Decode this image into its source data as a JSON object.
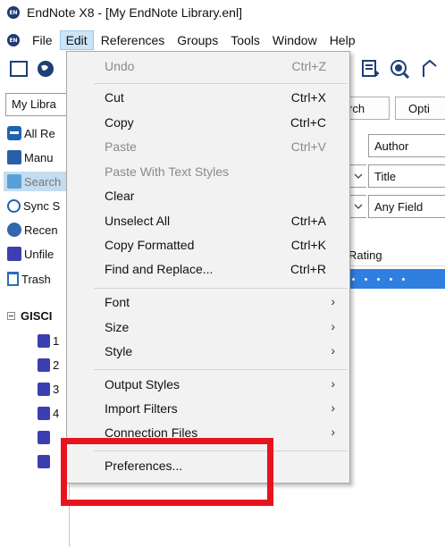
{
  "window": {
    "title": "EndNote X8 - [My EndNote Library.enl]",
    "app_badge": "EN"
  },
  "menubar": {
    "items": [
      "File",
      "Edit",
      "References",
      "Groups",
      "Tools",
      "Window",
      "Help"
    ],
    "active": "Edit"
  },
  "left_panel": {
    "library_dropdown": "My Libra",
    "items": [
      {
        "label": "All Re",
        "icon": "all-references-icon"
      },
      {
        "label": "Manu",
        "icon": "manuscript-icon"
      },
      {
        "label": "Search",
        "icon": "search-icon",
        "selected": true
      },
      {
        "label": "Sync S",
        "icon": "sync-status-icon"
      },
      {
        "label": "Recen",
        "icon": "recently-added-icon"
      },
      {
        "label": "Unfile",
        "icon": "unfiled-icon"
      },
      {
        "label": "Trash",
        "icon": "trash-icon"
      }
    ],
    "group_set": "GISCI",
    "groups": [
      "1",
      "2",
      "3",
      "4",
      "",
      ""
    ]
  },
  "right_panel": {
    "search_button_tail": "rch",
    "options_button": "Opti",
    "fields": [
      "Author",
      "Title",
      "Any Field"
    ],
    "rating_header": "Rating"
  },
  "edit_menu": {
    "items": [
      {
        "label": "Undo",
        "shortcut": "Ctrl+Z",
        "disabled": true
      },
      {
        "label": "Cut",
        "shortcut": "Ctrl+X"
      },
      {
        "label": "Copy",
        "shortcut": "Ctrl+C"
      },
      {
        "label": "Paste",
        "shortcut": "Ctrl+V",
        "disabled": true
      },
      {
        "label": "Paste With Text Styles",
        "shortcut": "",
        "disabled": true
      },
      {
        "label": "Clear",
        "shortcut": ""
      },
      {
        "label": "Unselect All",
        "shortcut": "Ctrl+A"
      },
      {
        "label": "Copy Formatted",
        "shortcut": "Ctrl+K"
      },
      {
        "label": "Find and Replace...",
        "shortcut": "Ctrl+R"
      },
      {
        "label": "Font",
        "submenu": true
      },
      {
        "label": "Size",
        "submenu": true
      },
      {
        "label": "Style",
        "submenu": true
      },
      {
        "label": "Output Styles",
        "submenu": true
      },
      {
        "label": "Import Filters",
        "submenu": true
      },
      {
        "label": "Connection Files",
        "submenu": true
      },
      {
        "label": "Preferences..."
      }
    ],
    "submenu_glyph": "›"
  },
  "highlight": {
    "color": "#e8141c"
  }
}
